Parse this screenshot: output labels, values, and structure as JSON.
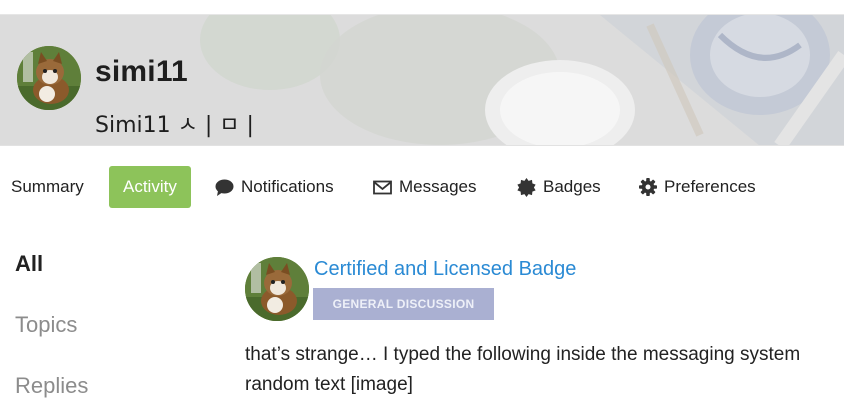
{
  "profile": {
    "username": "simi11",
    "full_name": "Simi11 ㅅ | ㅁ |"
  },
  "nav": {
    "items": [
      {
        "label": "Summary",
        "icon": ""
      },
      {
        "label": "Activity",
        "icon": ""
      },
      {
        "label": "Notifications",
        "icon": "speech-bubble-icon"
      },
      {
        "label": "Messages",
        "icon": "envelope-icon"
      },
      {
        "label": "Badges",
        "icon": "certificate-icon"
      },
      {
        "label": "Preferences",
        "icon": "gear-icon"
      }
    ],
    "active_color": "#8dc35a"
  },
  "sidebar": {
    "items": [
      {
        "label": "All"
      },
      {
        "label": "Topics"
      },
      {
        "label": "Replies"
      }
    ]
  },
  "activity": {
    "topic_title": "Certified and Licensed Badge",
    "category": "GENERAL DISCUSSION",
    "category_color": "#aab0d2",
    "link_color": "#2a8ad4",
    "excerpt_line1": "that’s strange… I typed the following inside the messaging system",
    "excerpt_line2": "random text [image]"
  }
}
